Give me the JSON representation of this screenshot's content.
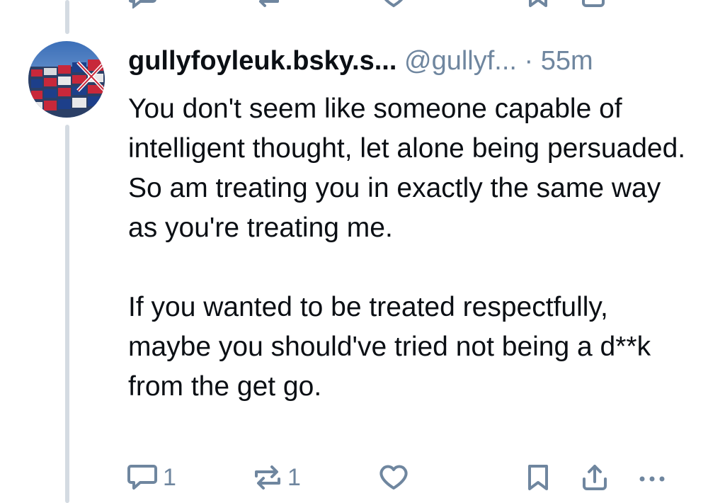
{
  "post": {
    "display_name": "gullyfoyleuk.bsky.s...",
    "handle": "@gullyf...",
    "separator": "·",
    "time": "55m",
    "paragraphs": [
      "You don't seem like someone capable of intelligent thought, let alone being persuaded. So am treating you in exactly the same way as you're treating me.",
      "If you wanted to be treated respectfully, maybe you should've tried not being a d**k from the get go."
    ],
    "actions": {
      "reply_count": "1",
      "repost_count": "1"
    },
    "icons": [
      "reply-icon",
      "repost-icon",
      "like-icon",
      "bookmark-icon",
      "share-icon",
      "more-icon"
    ]
  },
  "colors": {
    "text": "#0b0f14",
    "muted": "#6f869f",
    "thread_line": "#d4dbe2"
  }
}
